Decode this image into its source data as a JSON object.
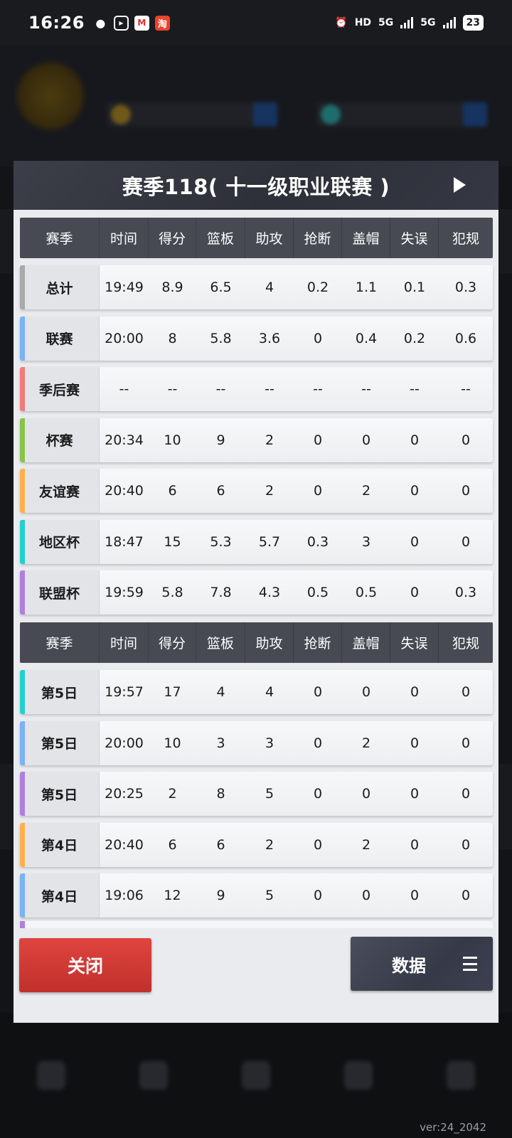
{
  "status_bar": {
    "time": "16:26",
    "battery": "23",
    "network_1": "5G",
    "network_2": "5G",
    "hd_label": "HD"
  },
  "modal": {
    "title": "赛季118( 十一级职业联赛 )",
    "columns": [
      "赛季",
      "时间",
      "得分",
      "篮板",
      "助攻",
      "抢断",
      "盖帽",
      "失误",
      "犯规"
    ],
    "season_rows": [
      {
        "label": "总计",
        "accent": "#a9a9a9",
        "values": [
          "19:49",
          "8.9",
          "6.5",
          "4",
          "0.2",
          "1.1",
          "0.1",
          "0.3"
        ]
      },
      {
        "label": "联赛",
        "accent": "#7ab3f5",
        "values": [
          "20:00",
          "8",
          "5.8",
          "3.6",
          "0",
          "0.4",
          "0.2",
          "0.6"
        ]
      },
      {
        "label": "季后赛",
        "accent": "#f07c7c",
        "values": [
          "--",
          "--",
          "--",
          "--",
          "--",
          "--",
          "--",
          "--"
        ]
      },
      {
        "label": "杯赛",
        "accent": "#8bc34a",
        "values": [
          "20:34",
          "10",
          "9",
          "2",
          "0",
          "0",
          "0",
          "0"
        ]
      },
      {
        "label": "友谊赛",
        "accent": "#ffb04a",
        "values": [
          "20:40",
          "6",
          "6",
          "2",
          "0",
          "2",
          "0",
          "0"
        ]
      },
      {
        "label": "地区杯",
        "accent": "#22d0d0",
        "values": [
          "18:47",
          "15",
          "5.3",
          "5.7",
          "0.3",
          "3",
          "0",
          "0"
        ]
      },
      {
        "label": "联盟杯",
        "accent": "#b07fe0",
        "values": [
          "19:59",
          "5.8",
          "7.8",
          "4.3",
          "0.5",
          "0.5",
          "0",
          "0.3"
        ]
      }
    ],
    "game_rows": [
      {
        "label": "第5日",
        "accent": "#22d0d0",
        "values": [
          "19:57",
          "17",
          "4",
          "4",
          "0",
          "0",
          "0",
          "0"
        ]
      },
      {
        "label": "第5日",
        "accent": "#7ab3f5",
        "values": [
          "20:00",
          "10",
          "3",
          "3",
          "0",
          "2",
          "0",
          "0"
        ]
      },
      {
        "label": "第5日",
        "accent": "#b07fe0",
        "values": [
          "20:25",
          "2",
          "8",
          "5",
          "0",
          "0",
          "0",
          "0"
        ]
      },
      {
        "label": "第4日",
        "accent": "#ffb04a",
        "values": [
          "20:40",
          "6",
          "6",
          "2",
          "0",
          "2",
          "0",
          "0"
        ]
      },
      {
        "label": "第4日",
        "accent": "#7ab3f5",
        "values": [
          "19:06",
          "12",
          "9",
          "5",
          "0",
          "0",
          "0",
          "0"
        ]
      }
    ],
    "close_label": "关闭",
    "data_label": "数据"
  },
  "version": "ver:24_2042"
}
